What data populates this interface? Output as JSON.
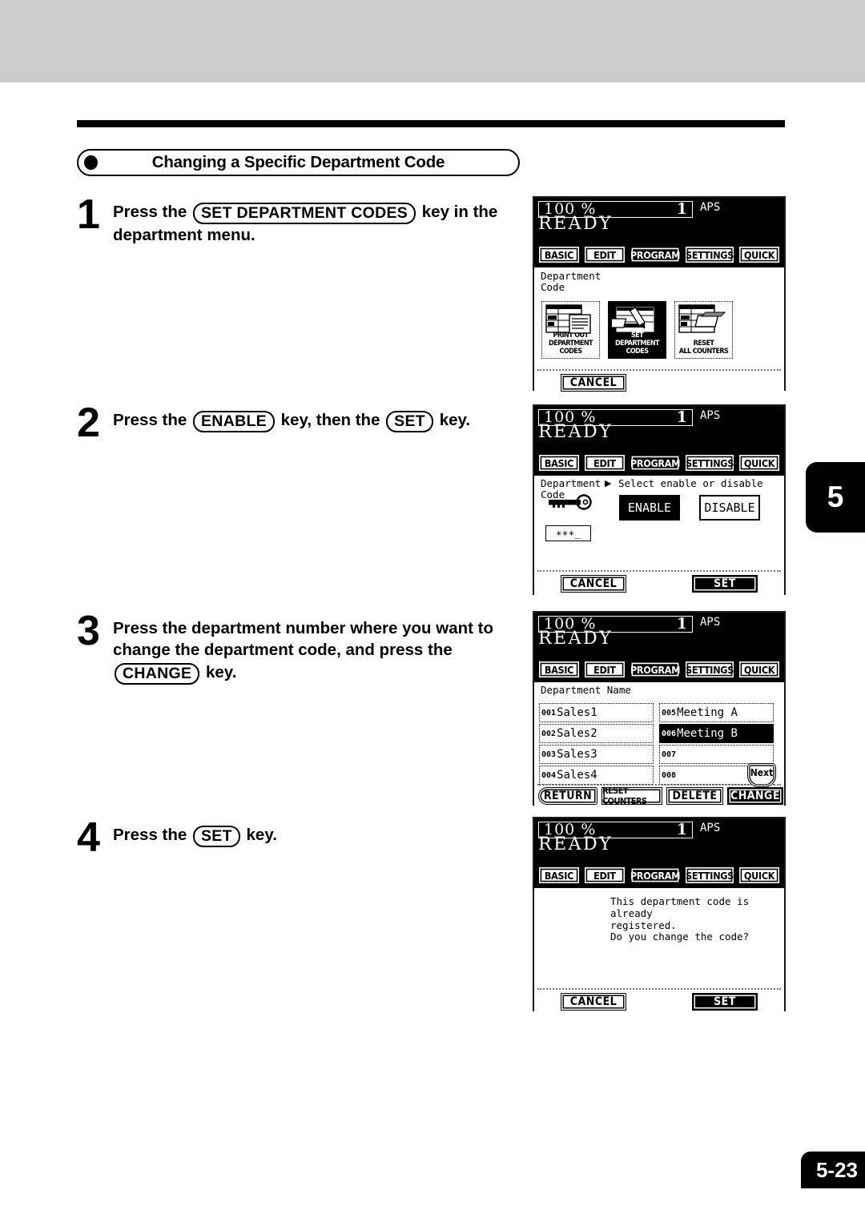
{
  "page": {
    "number": "5-23",
    "chapter_tab": "5"
  },
  "section": {
    "title": "Changing a Specific Department Code"
  },
  "steps": [
    {
      "number": "1",
      "lines": [
        [
          {
            "t": "text",
            "v": "Press the "
          },
          {
            "t": "key",
            "v": "SET DEPARTMENT CODES"
          },
          {
            "t": "text",
            "v": " key in the"
          }
        ],
        [
          {
            "t": "text",
            "v": "department menu."
          }
        ]
      ]
    },
    {
      "number": "2",
      "lines": [
        [
          {
            "t": "text",
            "v": "Press the "
          },
          {
            "t": "key",
            "v": "ENABLE"
          },
          {
            "t": "text",
            "v": " key, then the "
          },
          {
            "t": "key",
            "v": "SET"
          },
          {
            "t": "text",
            "v": " key."
          }
        ]
      ]
    },
    {
      "number": "3",
      "lines": [
        [
          {
            "t": "text",
            "v": "Press the department number where you want to"
          }
        ],
        [
          {
            "t": "text",
            "v": "change  the  department  code,  and  press  the"
          }
        ],
        [
          {
            "t": "key",
            "v": "CHANGE"
          },
          {
            "t": "text",
            "v": " key."
          }
        ]
      ]
    },
    {
      "number": "4",
      "lines": [
        [
          {
            "t": "text",
            "v": "Press the "
          },
          {
            "t": "key",
            "v": "SET"
          },
          {
            "t": "text",
            "v": " key."
          }
        ]
      ]
    }
  ],
  "lcd_common": {
    "zoom_ratio": "100",
    "percent_sign": "%",
    "copy_count": "1",
    "paper_mode": "APS",
    "status": "READY",
    "tabs": [
      {
        "label": "BASIC",
        "selected": false
      },
      {
        "label": "EDIT",
        "selected": false
      },
      {
        "label": "PROGRAM",
        "selected": true
      },
      {
        "label": "SETTINGS",
        "selected": false
      },
      {
        "label": "QUICK",
        "selected": false
      }
    ]
  },
  "screen1": {
    "caption": "Department\nCode",
    "icons": [
      {
        "label": "PRINT OUT\nDEPARTMENT CODES",
        "icon": "printout-department-codes-icon",
        "selected": false
      },
      {
        "label": "SET\nDEPARTMENT CODES",
        "icon": "set-department-codes-icon",
        "selected": true
      },
      {
        "label": "RESET\nALL COUNTERS",
        "icon": "reset-all-counters-icon",
        "selected": false
      }
    ],
    "cancel_label": "CANCEL"
  },
  "screen2": {
    "caption": "Department\nCode",
    "prompt_arrow": "▶",
    "prompt": "Select enable or disable",
    "key_icon": "password-key-icon",
    "masked_code": "∗∗∗_",
    "enable_label": "ENABLE",
    "disable_label": "DISABLE",
    "cancel_label": "CANCEL",
    "set_label": "SET"
  },
  "screen3": {
    "caption": "Department Name",
    "departments_left": [
      {
        "no": "001",
        "name": "Sales1",
        "selected": false
      },
      {
        "no": "002",
        "name": "Sales2",
        "selected": false
      },
      {
        "no": "003",
        "name": "Sales3",
        "selected": false
      },
      {
        "no": "004",
        "name": "Sales4",
        "selected": false
      }
    ],
    "departments_right": [
      {
        "no": "005",
        "name": "Meeting A",
        "selected": false
      },
      {
        "no": "006",
        "name": "Meeting B",
        "selected": true
      },
      {
        "no": "007",
        "name": "",
        "selected": false
      },
      {
        "no": "008",
        "name": "",
        "selected": false
      }
    ],
    "next_label": "Next",
    "buttons": [
      {
        "label": "RETURN",
        "selected": false
      },
      {
        "label": "RESET COUNTERS",
        "selected": false
      },
      {
        "label": "DELETE",
        "selected": false
      },
      {
        "label": "CHANGE",
        "selected": true
      }
    ]
  },
  "screen4": {
    "message": "This department code is already\nregistered.\nDo you change the code?",
    "cancel_label": "CANCEL",
    "set_label": "SET"
  }
}
